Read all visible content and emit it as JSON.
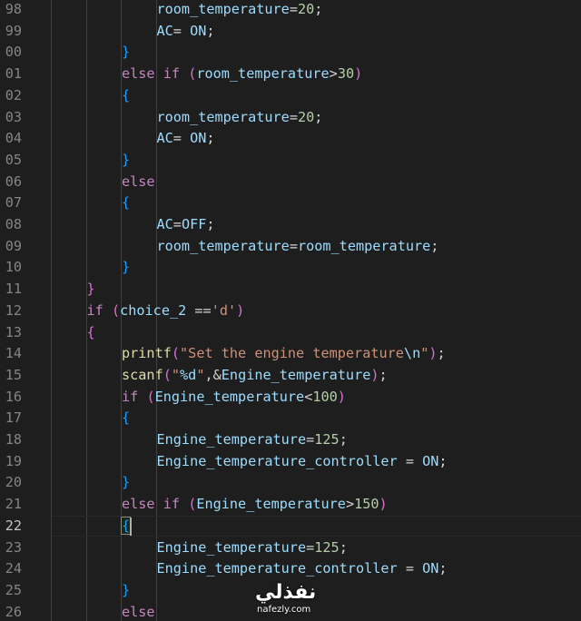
{
  "editor": {
    "cursor_line": "22",
    "lines": [
      {
        "number": "98",
        "indent": 3,
        "tokens": [
          [
            "id",
            "room_temperature"
          ],
          [
            "plain",
            "="
          ],
          [
            "num",
            "20"
          ],
          [
            "plain",
            ";"
          ]
        ]
      },
      {
        "number": "99",
        "indent": 3,
        "tokens": [
          [
            "id",
            "AC"
          ],
          [
            "plain",
            "= "
          ],
          [
            "id",
            "ON"
          ],
          [
            "plain",
            ";"
          ]
        ]
      },
      {
        "number": "00",
        "indent": 2,
        "tokens": [
          [
            "brace",
            "}"
          ]
        ]
      },
      {
        "number": "01",
        "indent": 2,
        "tokens": [
          [
            "ctrl",
            "else"
          ],
          [
            "plain",
            " "
          ],
          [
            "ctrl",
            "if"
          ],
          [
            "plain",
            " "
          ],
          [
            "paren",
            "("
          ],
          [
            "id",
            "room_temperature"
          ],
          [
            "plain",
            ">"
          ],
          [
            "num",
            "30"
          ],
          [
            "paren",
            ")"
          ]
        ]
      },
      {
        "number": "02",
        "indent": 2,
        "tokens": [
          [
            "brace",
            "{"
          ]
        ]
      },
      {
        "number": "03",
        "indent": 3,
        "tokens": [
          [
            "id",
            "room_temperature"
          ],
          [
            "plain",
            "="
          ],
          [
            "num",
            "20"
          ],
          [
            "plain",
            ";"
          ]
        ]
      },
      {
        "number": "04",
        "indent": 3,
        "tokens": [
          [
            "id",
            "AC"
          ],
          [
            "plain",
            "= "
          ],
          [
            "id",
            "ON"
          ],
          [
            "plain",
            ";"
          ]
        ]
      },
      {
        "number": "05",
        "indent": 2,
        "tokens": [
          [
            "brace",
            "}"
          ]
        ]
      },
      {
        "number": "06",
        "indent": 2,
        "tokens": [
          [
            "ctrl",
            "else"
          ]
        ]
      },
      {
        "number": "07",
        "indent": 2,
        "tokens": [
          [
            "brace",
            "{"
          ]
        ]
      },
      {
        "number": "08",
        "indent": 3,
        "tokens": [
          [
            "id",
            "AC"
          ],
          [
            "plain",
            "="
          ],
          [
            "id",
            "OFF"
          ],
          [
            "plain",
            ";"
          ]
        ]
      },
      {
        "number": "09",
        "indent": 3,
        "tokens": [
          [
            "id",
            "room_temperature"
          ],
          [
            "plain",
            "="
          ],
          [
            "id",
            "room_temperature"
          ],
          [
            "plain",
            ";"
          ]
        ]
      },
      {
        "number": "10",
        "indent": 2,
        "tokens": [
          [
            "brace",
            "}"
          ]
        ]
      },
      {
        "number": "11",
        "indent": 1,
        "tokens": [
          [
            "paren",
            "}"
          ]
        ]
      },
      {
        "number": "12",
        "indent": 1,
        "tokens": [
          [
            "ctrl",
            "if"
          ],
          [
            "plain",
            " "
          ],
          [
            "paren",
            "("
          ],
          [
            "id",
            "choice_2"
          ],
          [
            "plain",
            " =="
          ],
          [
            "str",
            "'d'"
          ],
          [
            "paren",
            ")"
          ]
        ]
      },
      {
        "number": "13",
        "indent": 1,
        "tokens": [
          [
            "paren",
            "{"
          ]
        ]
      },
      {
        "number": "14",
        "indent": 2,
        "tokens": [
          [
            "func",
            "printf"
          ],
          [
            "paren",
            "("
          ],
          [
            "str",
            "\"Set the engine temperature"
          ],
          [
            "fmt",
            "\\n"
          ],
          [
            "str",
            "\""
          ],
          [
            "paren",
            ")"
          ],
          [
            "plain",
            ";"
          ]
        ]
      },
      {
        "number": "15",
        "indent": 2,
        "tokens": [
          [
            "func",
            "scanf"
          ],
          [
            "paren",
            "("
          ],
          [
            "str",
            "\""
          ],
          [
            "fmt",
            "%d"
          ],
          [
            "str",
            "\""
          ],
          [
            "plain",
            ",&"
          ],
          [
            "id",
            "Engine_temperature"
          ],
          [
            "paren",
            ")"
          ],
          [
            "plain",
            ";"
          ]
        ]
      },
      {
        "number": "16",
        "indent": 2,
        "tokens": [
          [
            "ctrl",
            "if"
          ],
          [
            "plain",
            " "
          ],
          [
            "paren",
            "("
          ],
          [
            "id",
            "Engine_temperature"
          ],
          [
            "plain",
            "<"
          ],
          [
            "num",
            "100"
          ],
          [
            "paren",
            ")"
          ]
        ]
      },
      {
        "number": "17",
        "indent": 2,
        "tokens": [
          [
            "brace",
            "{"
          ]
        ]
      },
      {
        "number": "18",
        "indent": 3,
        "tokens": [
          [
            "id",
            "Engine_temperature"
          ],
          [
            "plain",
            "="
          ],
          [
            "num",
            "125"
          ],
          [
            "plain",
            ";"
          ]
        ]
      },
      {
        "number": "19",
        "indent": 3,
        "tokens": [
          [
            "id",
            "Engine_temperature_controller"
          ],
          [
            "plain",
            " = "
          ],
          [
            "id",
            "ON"
          ],
          [
            "plain",
            ";"
          ]
        ]
      },
      {
        "number": "20",
        "indent": 2,
        "tokens": [
          [
            "brace",
            "}"
          ]
        ]
      },
      {
        "number": "21",
        "indent": 2,
        "tokens": [
          [
            "ctrl",
            "else"
          ],
          [
            "plain",
            " "
          ],
          [
            "ctrl",
            "if"
          ],
          [
            "plain",
            " "
          ],
          [
            "paren",
            "("
          ],
          [
            "id",
            "Engine_temperature"
          ],
          [
            "plain",
            ">"
          ],
          [
            "num",
            "150"
          ],
          [
            "paren",
            ")"
          ]
        ]
      },
      {
        "number": "22",
        "indent": 2,
        "tokens": [
          [
            "brace",
            "{"
          ]
        ]
      },
      {
        "number": "23",
        "indent": 3,
        "tokens": [
          [
            "id",
            "Engine_temperature"
          ],
          [
            "plain",
            "="
          ],
          [
            "num",
            "125"
          ],
          [
            "plain",
            ";"
          ]
        ]
      },
      {
        "number": "24",
        "indent": 3,
        "tokens": [
          [
            "id",
            "Engine_temperature_controller"
          ],
          [
            "plain",
            " = "
          ],
          [
            "id",
            "ON"
          ],
          [
            "plain",
            ";"
          ]
        ]
      },
      {
        "number": "25",
        "indent": 2,
        "tokens": [
          [
            "brace",
            "}"
          ]
        ]
      },
      {
        "number": "26",
        "indent": 2,
        "tokens": [
          [
            "ctrl",
            "else"
          ]
        ]
      }
    ]
  },
  "colors": {
    "background": "#1e1e1e",
    "line_number": "#858585",
    "control_keyword": "#c586c0",
    "identifier": "#9cdcfe",
    "function": "#dcdcaa",
    "string": "#ce9178",
    "number": "#b5cea8",
    "bracket_blue": "#179fff",
    "bracket_purple": "#da70d6"
  },
  "watermark": {
    "arabic": "نفذلي",
    "url": "nafezly.com"
  }
}
